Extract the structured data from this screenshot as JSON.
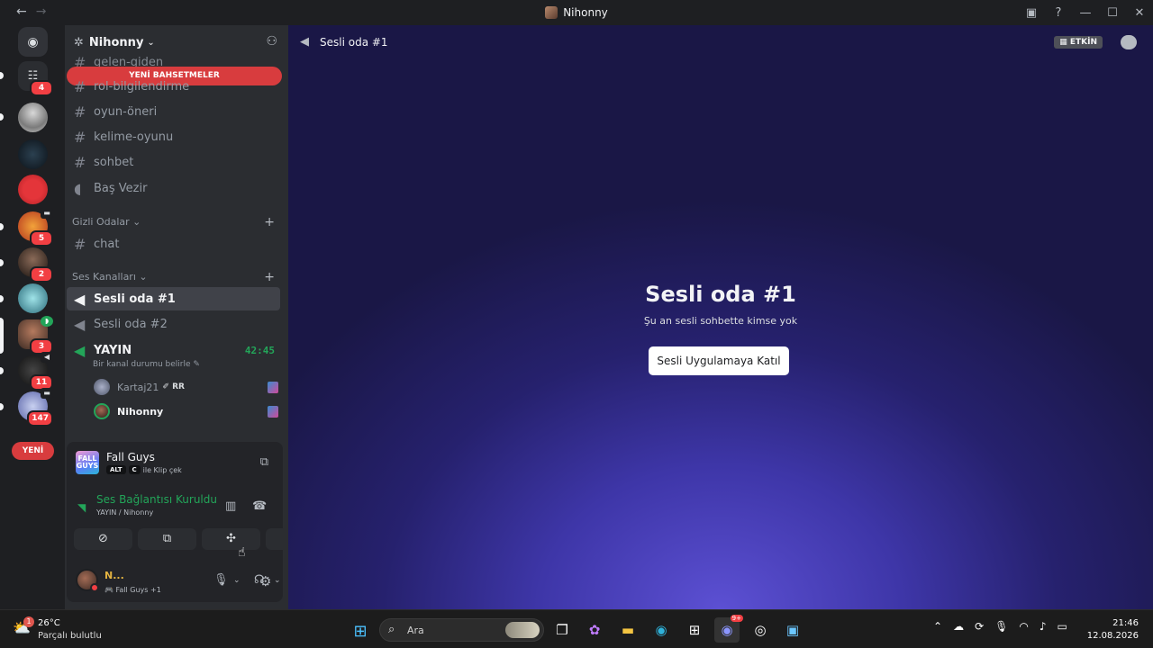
{
  "window": {
    "title": "Nihonny"
  },
  "server_rail": {
    "badges": [
      "4",
      "5",
      "2",
      "3",
      "11",
      "147"
    ],
    "new_label": "YENİ"
  },
  "channel_sidebar": {
    "server_name": "Nihonny",
    "new_mentions": "YENİ BAHSETMELER",
    "channels_top": [
      "gelen-giden",
      "rol-bilgilendirme",
      "oyun-öneri",
      "kelime-oyunu",
      "sohbet",
      "Baş Vezir"
    ],
    "categories": [
      {
        "name": "Gizli Odalar",
        "channels": [
          "chat"
        ]
      },
      {
        "name": "Ses Kanalları",
        "channels": [
          "Sesli oda #1",
          "Sesli oda #2",
          "YAYIN"
        ]
      }
    ],
    "yayin_time": "42:45",
    "yayin_status": "Bir kanal durumu belirle",
    "members": [
      {
        "name": "Kartaj21",
        "tag": "RR"
      },
      {
        "name": "Nihonny",
        "tag": ""
      }
    ]
  },
  "activity": {
    "game": "Fall Guys",
    "game_logo_text": "FALL GUYS",
    "key1": "ALT",
    "key2": "C",
    "hint": "ile Klip çek"
  },
  "voice_status": {
    "title": "Ses Bağlantısı Kuruldu",
    "subtitle": "YAYIN / Nihonny"
  },
  "user_panel": {
    "name": "N...",
    "status": "Fall Guys +1"
  },
  "main": {
    "channel_title": "Sesli oda #1",
    "events_label": "ETKİN",
    "empty_title": "Sesli oda #1",
    "empty_subtitle": "Şu an sesli sohbette kimse yok",
    "join_button": "Sesli Uygulamaya Katıl"
  },
  "taskbar": {
    "temperature": "26°C",
    "weather": "Parçalı bulutlu",
    "weather_badge": "1",
    "search_placeholder": "Ara",
    "time": "21:46",
    "date": "12.08.2026",
    "discord_badge": "9+"
  },
  "colors": {
    "accent": "#5865f2",
    "danger": "#f23f43",
    "online": "#23a559"
  }
}
